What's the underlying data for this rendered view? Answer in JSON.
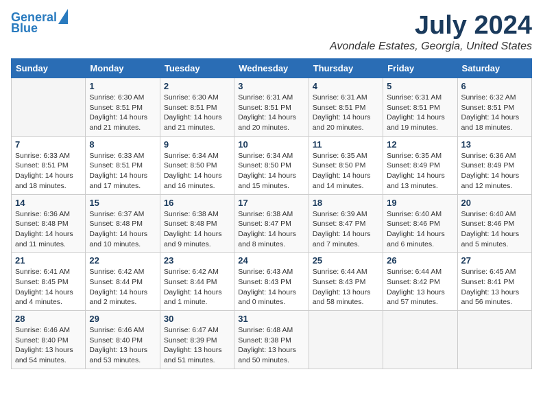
{
  "header": {
    "logo_line1": "General",
    "logo_line2": "Blue",
    "month_year": "July 2024",
    "location": "Avondale Estates, Georgia, United States"
  },
  "weekdays": [
    "Sunday",
    "Monday",
    "Tuesday",
    "Wednesday",
    "Thursday",
    "Friday",
    "Saturday"
  ],
  "weeks": [
    [
      {
        "day": "",
        "info": ""
      },
      {
        "day": "1",
        "info": "Sunrise: 6:30 AM\nSunset: 8:51 PM\nDaylight: 14 hours\nand 21 minutes."
      },
      {
        "day": "2",
        "info": "Sunrise: 6:30 AM\nSunset: 8:51 PM\nDaylight: 14 hours\nand 21 minutes."
      },
      {
        "day": "3",
        "info": "Sunrise: 6:31 AM\nSunset: 8:51 PM\nDaylight: 14 hours\nand 20 minutes."
      },
      {
        "day": "4",
        "info": "Sunrise: 6:31 AM\nSunset: 8:51 PM\nDaylight: 14 hours\nand 20 minutes."
      },
      {
        "day": "5",
        "info": "Sunrise: 6:31 AM\nSunset: 8:51 PM\nDaylight: 14 hours\nand 19 minutes."
      },
      {
        "day": "6",
        "info": "Sunrise: 6:32 AM\nSunset: 8:51 PM\nDaylight: 14 hours\nand 18 minutes."
      }
    ],
    [
      {
        "day": "7",
        "info": "Sunrise: 6:33 AM\nSunset: 8:51 PM\nDaylight: 14 hours\nand 18 minutes."
      },
      {
        "day": "8",
        "info": "Sunrise: 6:33 AM\nSunset: 8:51 PM\nDaylight: 14 hours\nand 17 minutes."
      },
      {
        "day": "9",
        "info": "Sunrise: 6:34 AM\nSunset: 8:50 PM\nDaylight: 14 hours\nand 16 minutes."
      },
      {
        "day": "10",
        "info": "Sunrise: 6:34 AM\nSunset: 8:50 PM\nDaylight: 14 hours\nand 15 minutes."
      },
      {
        "day": "11",
        "info": "Sunrise: 6:35 AM\nSunset: 8:50 PM\nDaylight: 14 hours\nand 14 minutes."
      },
      {
        "day": "12",
        "info": "Sunrise: 6:35 AM\nSunset: 8:49 PM\nDaylight: 14 hours\nand 13 minutes."
      },
      {
        "day": "13",
        "info": "Sunrise: 6:36 AM\nSunset: 8:49 PM\nDaylight: 14 hours\nand 12 minutes."
      }
    ],
    [
      {
        "day": "14",
        "info": "Sunrise: 6:36 AM\nSunset: 8:48 PM\nDaylight: 14 hours\nand 11 minutes."
      },
      {
        "day": "15",
        "info": "Sunrise: 6:37 AM\nSunset: 8:48 PM\nDaylight: 14 hours\nand 10 minutes."
      },
      {
        "day": "16",
        "info": "Sunrise: 6:38 AM\nSunset: 8:48 PM\nDaylight: 14 hours\nand 9 minutes."
      },
      {
        "day": "17",
        "info": "Sunrise: 6:38 AM\nSunset: 8:47 PM\nDaylight: 14 hours\nand 8 minutes."
      },
      {
        "day": "18",
        "info": "Sunrise: 6:39 AM\nSunset: 8:47 PM\nDaylight: 14 hours\nand 7 minutes."
      },
      {
        "day": "19",
        "info": "Sunrise: 6:40 AM\nSunset: 8:46 PM\nDaylight: 14 hours\nand 6 minutes."
      },
      {
        "day": "20",
        "info": "Sunrise: 6:40 AM\nSunset: 8:46 PM\nDaylight: 14 hours\nand 5 minutes."
      }
    ],
    [
      {
        "day": "21",
        "info": "Sunrise: 6:41 AM\nSunset: 8:45 PM\nDaylight: 14 hours\nand 4 minutes."
      },
      {
        "day": "22",
        "info": "Sunrise: 6:42 AM\nSunset: 8:44 PM\nDaylight: 14 hours\nand 2 minutes."
      },
      {
        "day": "23",
        "info": "Sunrise: 6:42 AM\nSunset: 8:44 PM\nDaylight: 14 hours\nand 1 minute."
      },
      {
        "day": "24",
        "info": "Sunrise: 6:43 AM\nSunset: 8:43 PM\nDaylight: 14 hours\nand 0 minutes."
      },
      {
        "day": "25",
        "info": "Sunrise: 6:44 AM\nSunset: 8:43 PM\nDaylight: 13 hours\nand 58 minutes."
      },
      {
        "day": "26",
        "info": "Sunrise: 6:44 AM\nSunset: 8:42 PM\nDaylight: 13 hours\nand 57 minutes."
      },
      {
        "day": "27",
        "info": "Sunrise: 6:45 AM\nSunset: 8:41 PM\nDaylight: 13 hours\nand 56 minutes."
      }
    ],
    [
      {
        "day": "28",
        "info": "Sunrise: 6:46 AM\nSunset: 8:40 PM\nDaylight: 13 hours\nand 54 minutes."
      },
      {
        "day": "29",
        "info": "Sunrise: 6:46 AM\nSunset: 8:40 PM\nDaylight: 13 hours\nand 53 minutes."
      },
      {
        "day": "30",
        "info": "Sunrise: 6:47 AM\nSunset: 8:39 PM\nDaylight: 13 hours\nand 51 minutes."
      },
      {
        "day": "31",
        "info": "Sunrise: 6:48 AM\nSunset: 8:38 PM\nDaylight: 13 hours\nand 50 minutes."
      },
      {
        "day": "",
        "info": ""
      },
      {
        "day": "",
        "info": ""
      },
      {
        "day": "",
        "info": ""
      }
    ]
  ]
}
